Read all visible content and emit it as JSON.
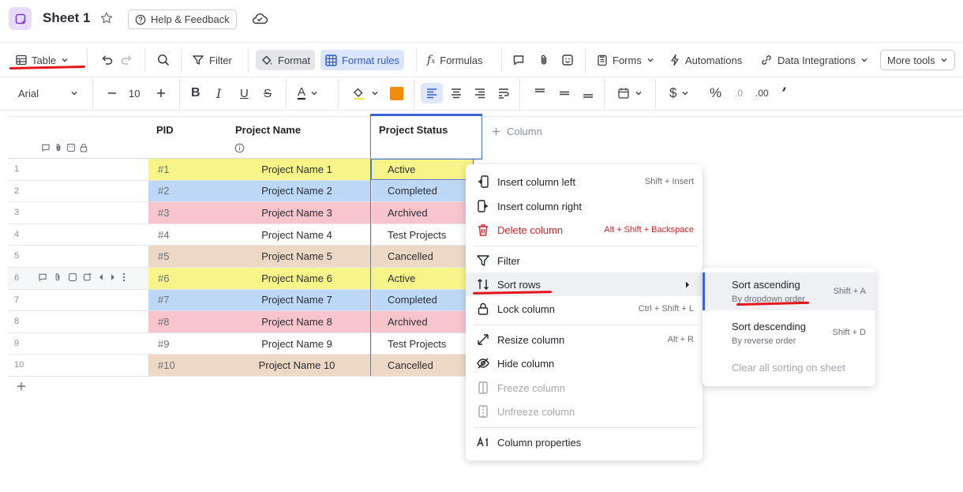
{
  "header": {
    "title": "Sheet 1",
    "help_label": "Help & Feedback"
  },
  "toolbar": {
    "view_label": "Table",
    "filter_label": "Filter",
    "format_label": "Format",
    "format_rules_label": "Format rules",
    "formulas_label": "Formulas",
    "forms_label": "Forms",
    "automations_label": "Automations",
    "data_integrations_label": "Data Integrations",
    "more_tools_label": "More tools"
  },
  "format_bar": {
    "font_family": "Arial",
    "font_size": "10",
    "fill_color": "#f28c0f"
  },
  "grid": {
    "columns": [
      "PID",
      "Project Name",
      "Project Status"
    ],
    "add_column_label": "Column",
    "rows": [
      {
        "num": "1",
        "pid": "#1",
        "name": "Project Name 1",
        "status": "Active",
        "color": "#f7f58a"
      },
      {
        "num": "2",
        "pid": "#2",
        "name": "Project Name 2",
        "status": "Completed",
        "color": "#bcd8f6"
      },
      {
        "num": "3",
        "pid": "#3",
        "name": "Project Name 3",
        "status": "Archived",
        "color": "#f8c5cd"
      },
      {
        "num": "4",
        "pid": "#4",
        "name": "Project Name 4",
        "status": "Test Projects",
        "color": "#ffffff"
      },
      {
        "num": "5",
        "pid": "#5",
        "name": "Project Name 5",
        "status": "Cancelled",
        "color": "#ecd8c4"
      },
      {
        "num": "6",
        "pid": "#6",
        "name": "Project Name 6",
        "status": "Active",
        "color": "#f7f58a"
      },
      {
        "num": "7",
        "pid": "#7",
        "name": "Project Name 7",
        "status": "Completed",
        "color": "#bcd8f6"
      },
      {
        "num": "8",
        "pid": "#8",
        "name": "Project Name 8",
        "status": "Archived",
        "color": "#f8c5cd"
      },
      {
        "num": "9",
        "pid": "#9",
        "name": "Project Name 9",
        "status": "Test Projects",
        "color": "#ffffff"
      },
      {
        "num": "10",
        "pid": "#10",
        "name": "Project Name 10",
        "status": "Cancelled",
        "color": "#ecd8c4"
      }
    ]
  },
  "context_menu": {
    "insert_left": {
      "label": "Insert column left",
      "shortcut": "Shift + Insert"
    },
    "insert_right": {
      "label": "Insert column right"
    },
    "delete": {
      "label": "Delete column",
      "shortcut": "Alt + Shift + Backspace"
    },
    "filter": {
      "label": "Filter"
    },
    "sort_rows": {
      "label": "Sort rows"
    },
    "lock": {
      "label": "Lock column",
      "shortcut": "Ctrl + Shift + L"
    },
    "resize": {
      "label": "Resize column",
      "shortcut": "Alt + R"
    },
    "hide": {
      "label": "Hide column"
    },
    "freeze": {
      "label": "Freeze column"
    },
    "unfreeze": {
      "label": "Unfreeze column"
    },
    "properties": {
      "label": "Column properties"
    }
  },
  "sort_submenu": {
    "ascending": {
      "label": "Sort ascending",
      "sub": "By dropdown order",
      "shortcut": "Shift + A"
    },
    "descending": {
      "label": "Sort descending",
      "sub": "By reverse order",
      "shortcut": "Shift + D"
    },
    "clear": {
      "label": "Clear all sorting on sheet"
    }
  },
  "colors": {
    "accent": "#3b62d6",
    "annotation_red": "#e3151d",
    "danger": "#d0262d"
  }
}
